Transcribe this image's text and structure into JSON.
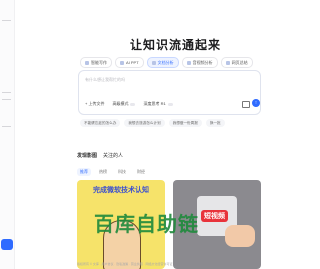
{
  "hero": {
    "title": "让知识流通起来"
  },
  "tabs": [
    {
      "label": "智能写作"
    },
    {
      "label": "AI PPT"
    },
    {
      "label": "文档分析"
    },
    {
      "label": "音视频分析"
    },
    {
      "label": "网页总结"
    }
  ],
  "input": {
    "placeholder": "有什么想让我帮忙的吗"
  },
  "options": {
    "upload": "+ 上传文件",
    "quality": "高级模式",
    "deep": "深度思考 R1"
  },
  "suggestions": [
    {
      "label": "不能健忘症的怎么办"
    },
    {
      "label": "我想去旅游怎么计划"
    },
    {
      "label": "我想做一份周报"
    },
    {
      "label": "换一批"
    }
  ],
  "feed": {
    "tabs": [
      "发现影图",
      "关注的人"
    ],
    "categories": [
      "推荐",
      "热榜",
      "科技",
      "财经"
    ]
  },
  "cards": {
    "a_text": "完成微软技术认知",
    "b_label": "短视频"
  },
  "watermark": "百库自助链",
  "footer": "版权所有 © 文库 · 用户协议 · 隐私政策 · 营业执照 · 网络文化经营许可证"
}
